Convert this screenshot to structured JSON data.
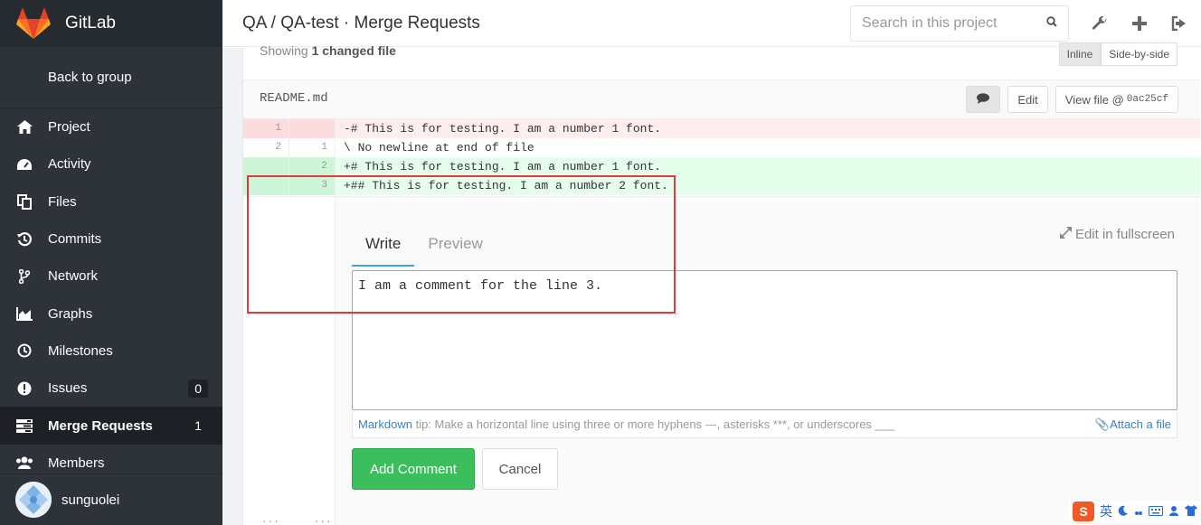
{
  "sidebar": {
    "app_title": "GitLab",
    "back_label": "Back to group",
    "items": [
      {
        "label": "Project",
        "icon": "home-icon"
      },
      {
        "label": "Activity",
        "icon": "dashboard-icon"
      },
      {
        "label": "Files",
        "icon": "files-icon"
      },
      {
        "label": "Commits",
        "icon": "history-icon"
      },
      {
        "label": "Network",
        "icon": "code-fork-icon"
      },
      {
        "label": "Graphs",
        "icon": "area-chart-icon"
      },
      {
        "label": "Milestones",
        "icon": "clock-icon"
      },
      {
        "label": "Issues",
        "icon": "exclamation-circle-icon",
        "count": "0"
      },
      {
        "label": "Merge Requests",
        "icon": "tasks-icon",
        "count": "1",
        "active": true
      },
      {
        "label": "Members",
        "icon": "users-icon"
      }
    ],
    "user_name": "sunguolei"
  },
  "header": {
    "breadcrumb": "QA / QA-test · Merge Requests",
    "search_placeholder": "Search in this project"
  },
  "diff": {
    "stats_prefix": "Showing",
    "stats_bold": "1 changed file",
    "view_inline": "Inline",
    "view_side": "Side-by-side",
    "file_name": "README.md",
    "edit_label": "Edit",
    "view_file_label": "View file @",
    "view_file_hash": "0ac25cf",
    "lines": [
      {
        "old": "1",
        "new": "",
        "text": "-# This is for testing. I am a number 1 font.",
        "type": "del"
      },
      {
        "old": "2",
        "new": "1",
        "text": "\\ No newline at end of file",
        "type": "ctx"
      },
      {
        "old": "",
        "new": "2",
        "text": "+# This is for testing. I am a number 1 font.",
        "type": "add"
      },
      {
        "old": "",
        "new": "3",
        "text": "+## This is for testing. I am a number 2 font.",
        "type": "add"
      }
    ],
    "gutter_dots_old": "...",
    "gutter_dots_new": "..."
  },
  "comment_form": {
    "tab_write": "Write",
    "tab_preview": "Preview",
    "fullscreen_label": "Edit in fullscreen",
    "text": "I am a comment for the line 3.",
    "tip_link": "Markdown",
    "tip_text": " tip: Make a horizontal line using three or more hyphens ---, asterisks ***, or underscores ___",
    "attach_label": "Attach a file",
    "add_label": "Add Comment",
    "cancel_label": "Cancel"
  },
  "ime": {
    "logo": "S",
    "lang": "英"
  },
  "colors": {
    "sidebar_bg": "#2d3339",
    "add_button": "#3bbf5c",
    "highlight_box": "#e0393e"
  }
}
